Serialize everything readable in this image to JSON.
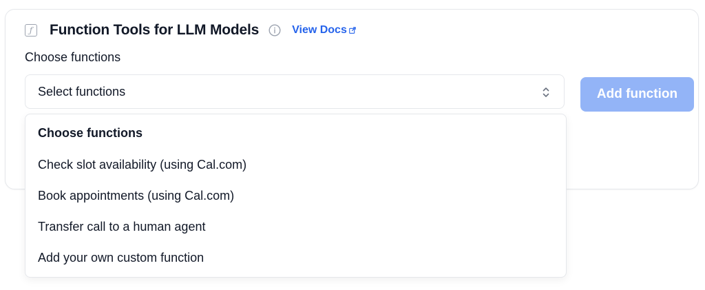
{
  "header": {
    "icon": "function-icon",
    "title": "Function Tools for LLM Models",
    "info_icon": "info-icon",
    "docs_label": "View Docs",
    "docs_icon": "external-link-icon"
  },
  "field": {
    "label": "Choose functions",
    "select_value": "Select functions",
    "select_icon": "chevron-up-down-icon"
  },
  "add_button": {
    "label": "Add function",
    "color": "#93b4f7"
  },
  "dropdown": {
    "header": "Choose functions",
    "items": [
      "Check slot availability (using Cal.com)",
      "Book appointments (using Cal.com)",
      "Transfer call to a human agent",
      "Add your own custom function"
    ]
  },
  "colors": {
    "accent": "#2563eb",
    "border": "#e5e7eb",
    "text": "#111827",
    "muted": "#9ca3af"
  }
}
